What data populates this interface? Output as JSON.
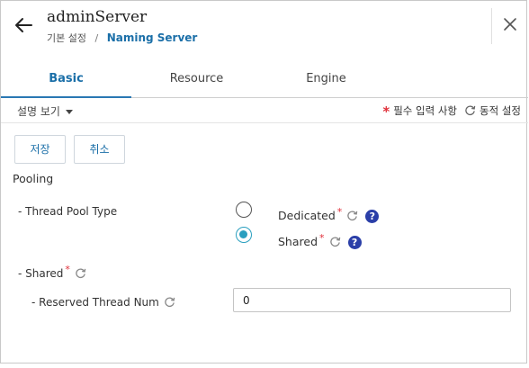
{
  "header": {
    "title": "adminServer",
    "breadcrumb_root": "기본 설정",
    "breadcrumb_sep": "/",
    "breadcrumb_current": "Naming Server"
  },
  "tabs": [
    {
      "label": "Basic",
      "active": true
    },
    {
      "label": "Resource",
      "active": false
    },
    {
      "label": "Engine",
      "active": false
    }
  ],
  "toolbar": {
    "description_toggle": "설명 보기",
    "required_legend": "필수 입력 사항",
    "dynamic_legend": "동적 설정",
    "required_mark": "*"
  },
  "actions": {
    "save_label": "저장",
    "cancel_label": "취소"
  },
  "form": {
    "section_title": "Pooling",
    "thread_pool_type": {
      "label": "- Thread Pool Type",
      "options": [
        {
          "label": "Dedicated",
          "selected": false,
          "help": "?"
        },
        {
          "label": "Shared",
          "selected": true,
          "help": "?"
        }
      ]
    },
    "shared": {
      "label": "- Shared",
      "reserved_thread_num": {
        "label": "- Reserved Thread Num",
        "value": "0"
      }
    }
  },
  "colors": {
    "accent": "#1b6fa8",
    "required": "#e0303a",
    "radio_selected": "#2a9fbf",
    "help_badge": "#2b3fa8"
  }
}
